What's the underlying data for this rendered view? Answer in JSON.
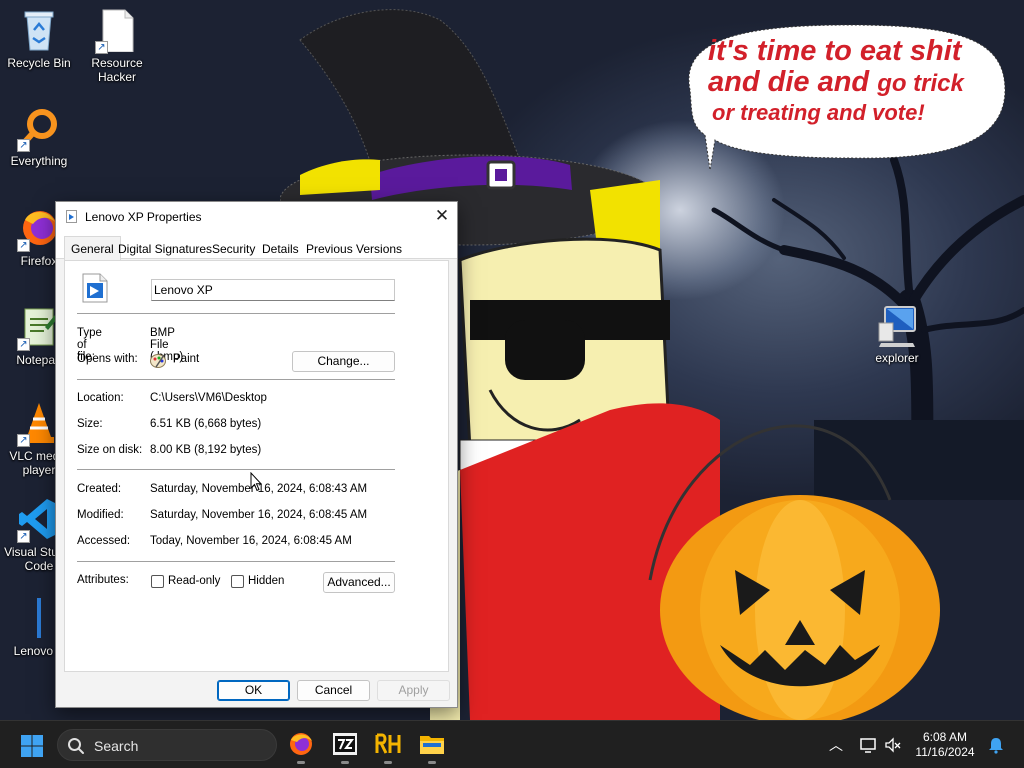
{
  "wallpaper": {
    "speech_bubble": {
      "line1": "it's time to eat shit",
      "line2a": "and die and ",
      "line2b": "go trick",
      "line3": "or treating and vote!"
    }
  },
  "desktop": {
    "icons": [
      {
        "label": "Recycle Bin",
        "icon": "recycle-bin-icon"
      },
      {
        "label": "Resource Hacker",
        "icon": "resource-hacker-icon"
      },
      {
        "label": "Everything",
        "icon": "everything-search-icon"
      },
      {
        "label": "Firefox",
        "icon": "firefox-icon"
      },
      {
        "label": "Notepad",
        "icon": "notepad-icon"
      },
      {
        "label": "VLC media player",
        "icon": "vlc-icon"
      },
      {
        "label": "Visual Studio Code",
        "icon": "vscode-icon"
      },
      {
        "label": "Lenovo X",
        "icon": "image-file-icon"
      },
      {
        "label": "explorer",
        "icon": "explorer-computer-icon"
      }
    ]
  },
  "dialog": {
    "title": "Lenovo XP Properties",
    "tabs": [
      "General",
      "Digital Signatures",
      "Security",
      "Details",
      "Previous Versions"
    ],
    "active_tab": "General",
    "file_name": "Lenovo XP",
    "fields": {
      "type_label": "Type of file:",
      "type_value": "BMP File (.bmp)",
      "opens_label": "Opens with:",
      "opens_value": "Paint",
      "change_button": "Change...",
      "location_label": "Location:",
      "location_value": "C:\\Users\\VM6\\Desktop",
      "size_label": "Size:",
      "size_value": "6.51 KB (6,668 bytes)",
      "disk_label": "Size on disk:",
      "disk_value": "8.00 KB (8,192 bytes)",
      "created_label": "Created:",
      "created_value": "Saturday, November 16, 2024, 6:08:43 AM",
      "modified_label": "Modified:",
      "modified_value": "Saturday, November 16, 2024, 6:08:45 AM",
      "accessed_label": "Accessed:",
      "accessed_value": "Today, November 16, 2024, 6:08:45 AM",
      "attributes_label": "Attributes:",
      "readonly_label": "Read-only",
      "readonly_checked": false,
      "hidden_label": "Hidden",
      "hidden_checked": false,
      "advanced_button": "Advanced..."
    },
    "buttons": {
      "ok": "OK",
      "cancel": "Cancel",
      "apply": "Apply"
    }
  },
  "taskbar": {
    "search_placeholder": "Search",
    "pinned": [
      "firefox-icon",
      "7zip-icon",
      "resource-hacker-icon",
      "file-explorer-icon"
    ],
    "clock": {
      "time": "6:08 AM",
      "date": "11/16/2024"
    }
  },
  "colors": {
    "accent": "#0067c0",
    "bubble_text": "#d2202a",
    "taskbar": "#202020"
  }
}
